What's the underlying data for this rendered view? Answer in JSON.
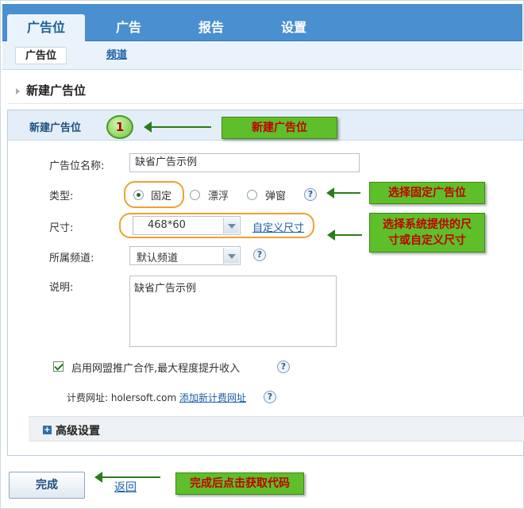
{
  "nav": {
    "tabs": [
      {
        "label": "广告位",
        "active": true
      },
      {
        "label": "广告"
      },
      {
        "label": "报告"
      },
      {
        "label": "设置"
      }
    ],
    "subtabs": [
      {
        "label": "广告位",
        "active": true
      },
      {
        "label": "频道"
      }
    ]
  },
  "page": {
    "title": "新建广告位"
  },
  "panel": {
    "title": "新建广告位",
    "name_label": "广告位名称:",
    "name_value": "缺省广告示例",
    "type_label": "类型:",
    "type_options": [
      "固定",
      "漂浮",
      "弹窗"
    ],
    "type_selected": "固定",
    "size_label": "尺寸:",
    "size_value": "468*60",
    "custom_size_link": "自定义尺寸",
    "channel_label": "所属频道:",
    "channel_value": "默认频道",
    "desc_label": "说明:",
    "desc_value": "缺省广告示例",
    "alliance_checkbox_label": "启用网盟推广合作,最大程度提升收入",
    "alliance_checked": true,
    "billing_label": "计费网址: holersoft.com",
    "add_billing_link": "添加新计费网址",
    "help_glyph": "?",
    "advanced_label": "高级设置"
  },
  "actions": {
    "done_label": "完成",
    "back_label": "返回"
  },
  "annotations": {
    "step_number": "1",
    "new_slot": "新建广告位",
    "choose_fixed": "选择固定广告位",
    "choose_size_line1": "选择系统提供的尺",
    "choose_size_line2": "寸或自定义尺寸",
    "after_done": "完成后点击获取代码"
  },
  "colors": {
    "nav_blue": "#4a8fcf",
    "callout_green": "#5fbf2a",
    "callout_text": "#c00000",
    "highlight_orange": "#f0a030"
  }
}
